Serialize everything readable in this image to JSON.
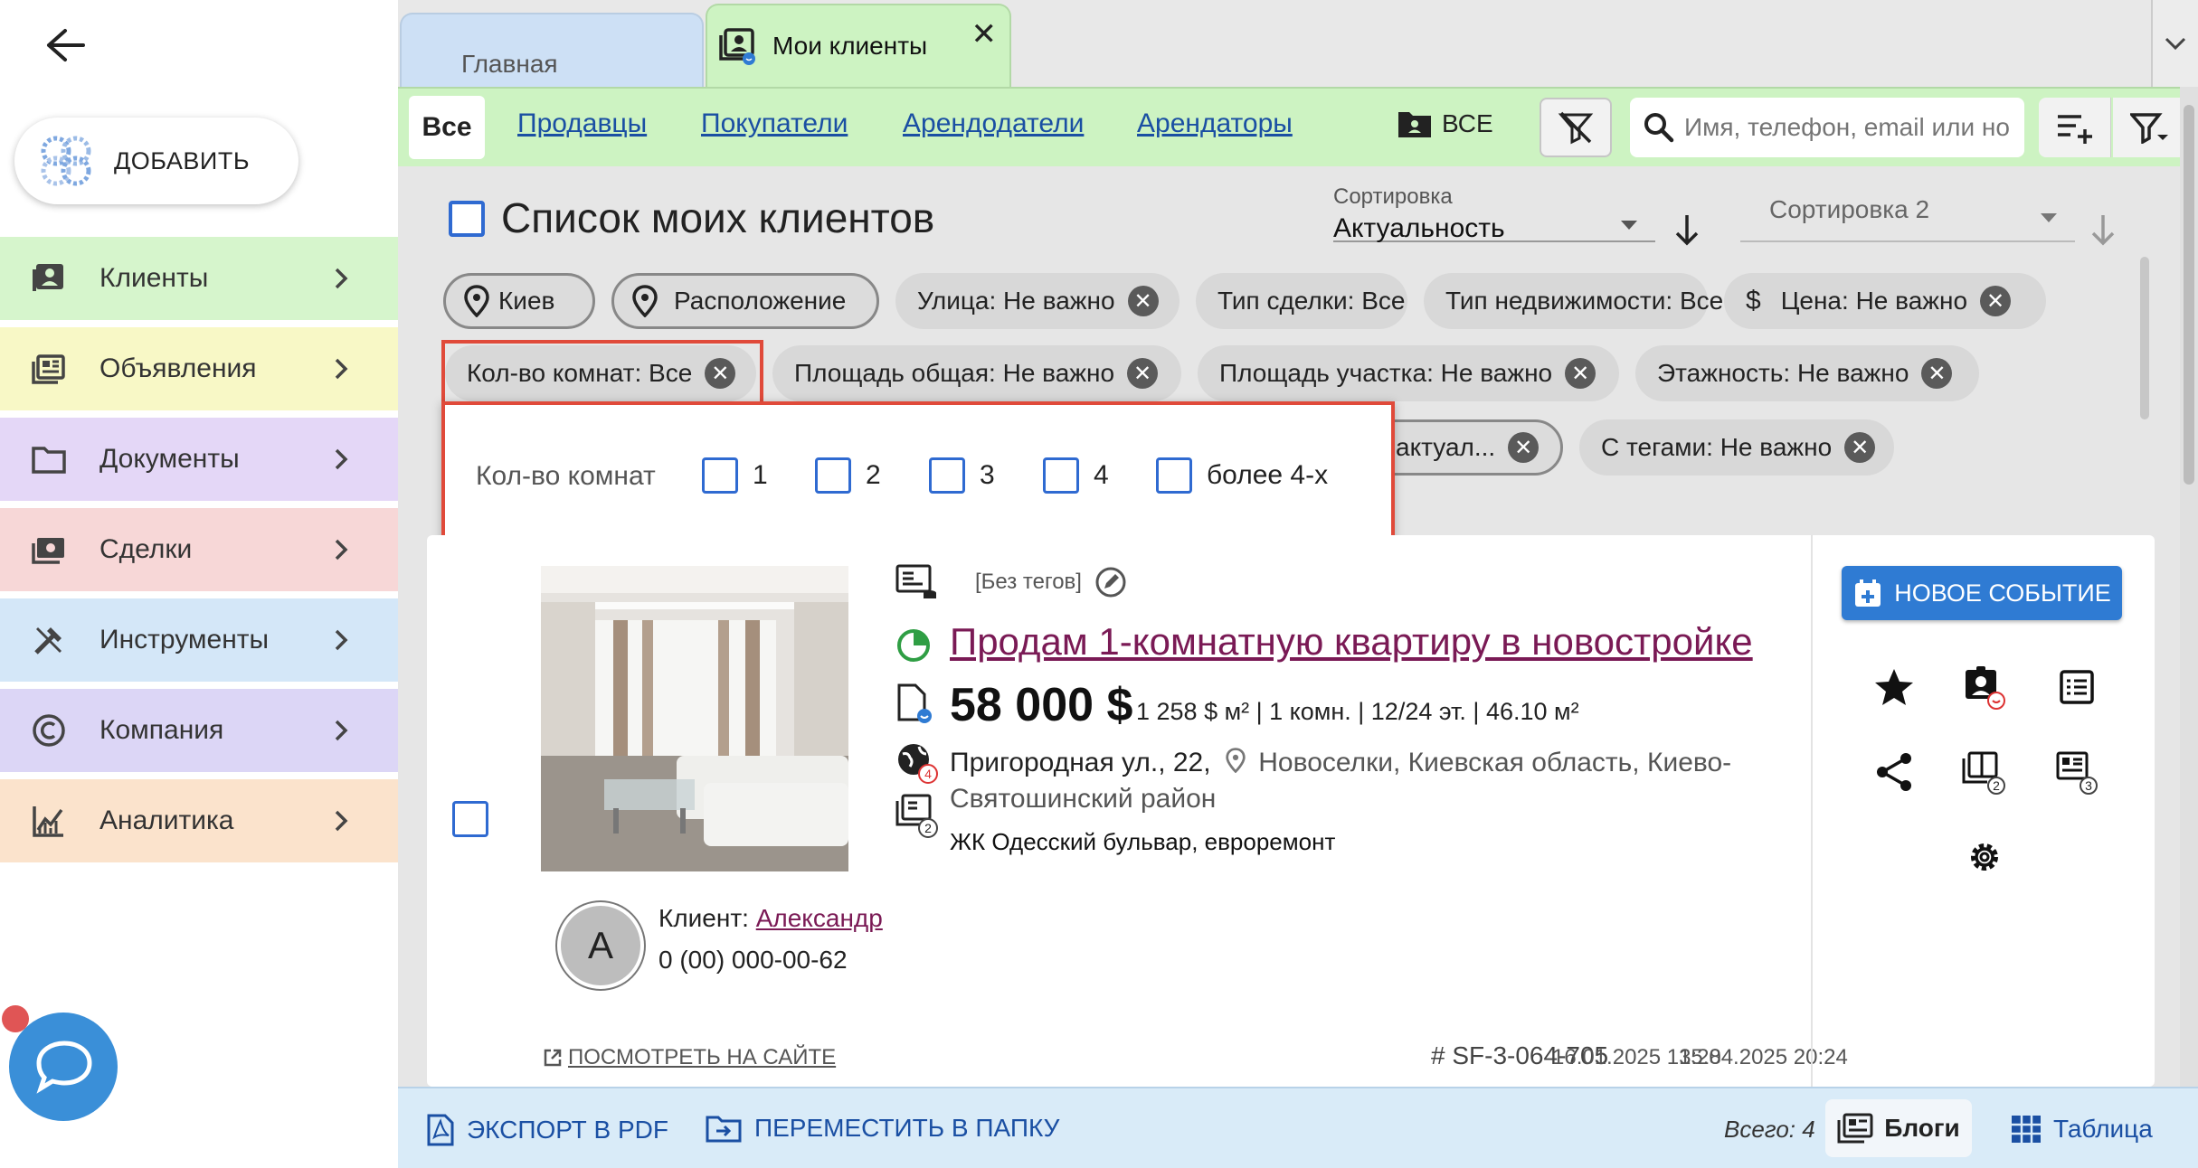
{
  "sidebar": {
    "add_label": "ДОБАВИТЬ",
    "items": [
      {
        "label": "Клиенты",
        "color": "#d6f5cc",
        "icon": "client-card-icon"
      },
      {
        "label": "Объявления",
        "color": "#f8f8c6",
        "icon": "listing-icon"
      },
      {
        "label": "Документы",
        "color": "#e4d7f7",
        "icon": "folder-icon"
      },
      {
        "label": "Сделки",
        "color": "#f7d7d7",
        "icon": "money-icon"
      },
      {
        "label": "Инструменты",
        "color": "#d4e7f8",
        "icon": "tools-icon"
      },
      {
        "label": "Компания",
        "color": "#dcd6f6",
        "icon": "copyright-icon"
      },
      {
        "label": "Аналитика",
        "color": "#fbe3cc",
        "icon": "analytics-icon"
      }
    ]
  },
  "tabs": {
    "home": "Главная",
    "clients": "Мои клиенты",
    "close": "✕"
  },
  "filterbar": {
    "all": "Все",
    "links": [
      "Продавцы",
      "Покупатели",
      "Арендодатели",
      "Арендаторы"
    ],
    "folder_all": "ВСЕ",
    "search_placeholder": "Имя, телефон, email или но"
  },
  "list": {
    "title": "Список моих клиентов",
    "sort1_caption": "Сортировка",
    "sort1_value": "Актуальность",
    "sort2_value": "Сортировка 2"
  },
  "chips": {
    "row1": [
      "Киев",
      "Расположение",
      "Улица: Не важно",
      "Тип сделки: Все",
      "Тип недвижимости: Все",
      "Цена: Не важно"
    ],
    "row2": [
      "Кол-во комнат: Все",
      "Площадь общая: Не важно",
      "Площадь участка: Не важно",
      "Этажность: Не важно"
    ],
    "row3": [
      "актуал...",
      "С тегами: Не важно"
    ]
  },
  "popup": {
    "caption": "Кол-во комнат",
    "options": [
      "1",
      "2",
      "3",
      "4",
      "более 4-х"
    ]
  },
  "card": {
    "tags": "[Без тегов]",
    "title": "Продам 1-комнатную квартиру в новостройке",
    "price": "58 000 $",
    "params": "1 258 $ м² | 1 комн. | 12/24 эт. | 46.10 м²",
    "street": "Пригородная ул., 22,",
    "city": "Новоселки, Киевская область, Киево-Святошинский район",
    "description": "ЖК Одесский бульвар, евроремонт",
    "globe_badge": "4",
    "doc_badge": "2",
    "client_label": "Клиент:",
    "client_name": "Александр",
    "client_initial": "A",
    "client_phone": "0 (00) 000-00-62",
    "view_site": "ПОСМОТРЕТЬ НА САЙТЕ",
    "code": "# SF-3-064-705",
    "date_created": "16.01.2025 13:28",
    "date_updated": "15.04.2025 20:24",
    "new_event": "НОВОЕ СОБЫТИЕ",
    "side_badge_2": "2",
    "side_badge_3": "3"
  },
  "bottombar": {
    "export_pdf": "ЭКСПОРТ В PDF",
    "move_folder": "ПЕРЕМЕСТИТЬ В ПАПКУ",
    "total": "Всего: 4",
    "blogs": "Блоги",
    "table": "Таблица"
  },
  "colors": {
    "accent_blue": "#2f6ad1",
    "tab_green": "#cdf3c2",
    "highlight_red": "#e04a3a",
    "title_purple": "#7a1a55"
  }
}
